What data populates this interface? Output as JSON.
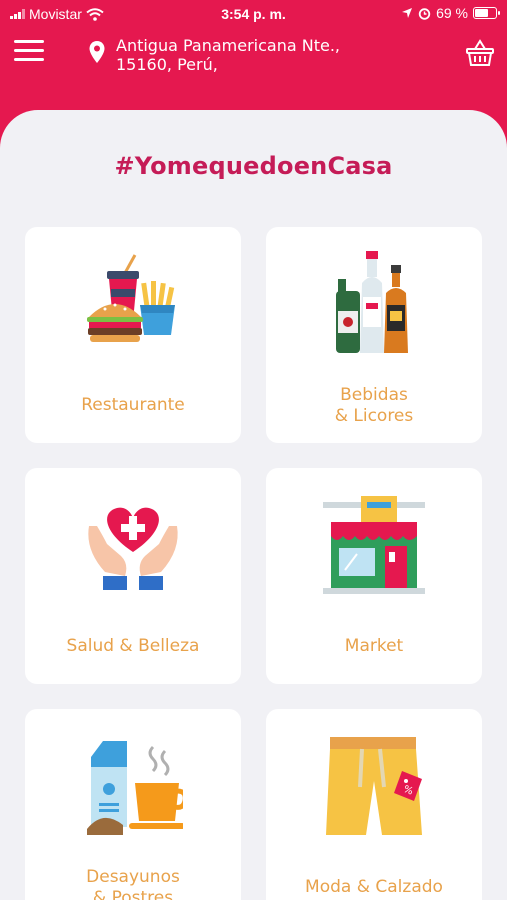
{
  "status_bar": {
    "carrier": "Movistar",
    "time": "3:54 p. m.",
    "battery": "69 %",
    "battery_level": 0.69
  },
  "header": {
    "address_line1": "Antigua Panamericana Nte.,",
    "address_line2": "15160, Perú,",
    "menu_icon": "hamburger-menu-icon",
    "location_icon": "map-pin-icon",
    "cart_icon": "shopping-basket-icon"
  },
  "main": {
    "hashtag": "#YomequedoenCasa",
    "categories": [
      {
        "line1": "Restaurante",
        "line2": "",
        "icon": "fast-food-icon"
      },
      {
        "line1": "Bebidas",
        "line2": "& Licores",
        "icon": "bottles-icon"
      },
      {
        "line1": "Salud & Belleza",
        "line2": "",
        "icon": "health-hands-icon"
      },
      {
        "line1": "Market",
        "line2": "",
        "icon": "store-icon"
      },
      {
        "line1": "Desayunos",
        "line2": "& Postres",
        "icon": "breakfast-icon"
      },
      {
        "line1": "Moda & Calzado",
        "line2": "",
        "icon": "shorts-icon"
      }
    ]
  },
  "colors": {
    "brand": "#e5184f",
    "title": "#c51c57",
    "label": "#e8a24b",
    "panel": "#f1f1f5"
  }
}
